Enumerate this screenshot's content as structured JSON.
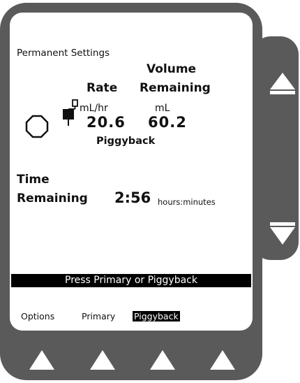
{
  "screen": {
    "title": "Permanent Settings",
    "rate": {
      "header": "Rate",
      "unit": "mL/hr",
      "value": "20.6"
    },
    "volume": {
      "header_line1": "Volume",
      "header_line2": "Remaining",
      "unit": "mL",
      "value": "60.2"
    },
    "mode": "Piggyback",
    "time": {
      "label_line1": "Time",
      "label_line2": "Remaining",
      "value": "2:56",
      "unit": "hours:minutes"
    },
    "message": "Press Primary or Piggyback",
    "softkeys": [
      {
        "label": "Options",
        "selected": false
      },
      {
        "label": "Primary",
        "selected": false
      },
      {
        "label": "Piggyback",
        "selected": true
      }
    ]
  },
  "icons": {
    "stop": "octagon-stop-icon",
    "bag": "iv-bag-icon",
    "up": "up-arrow-icon",
    "down": "down-arrow-icon",
    "softkey_button": "triangle-up-icon"
  },
  "colors": {
    "device": "#5a5a5a",
    "screen": "#ffffff",
    "text": "#111111",
    "highlight": "#000000"
  }
}
